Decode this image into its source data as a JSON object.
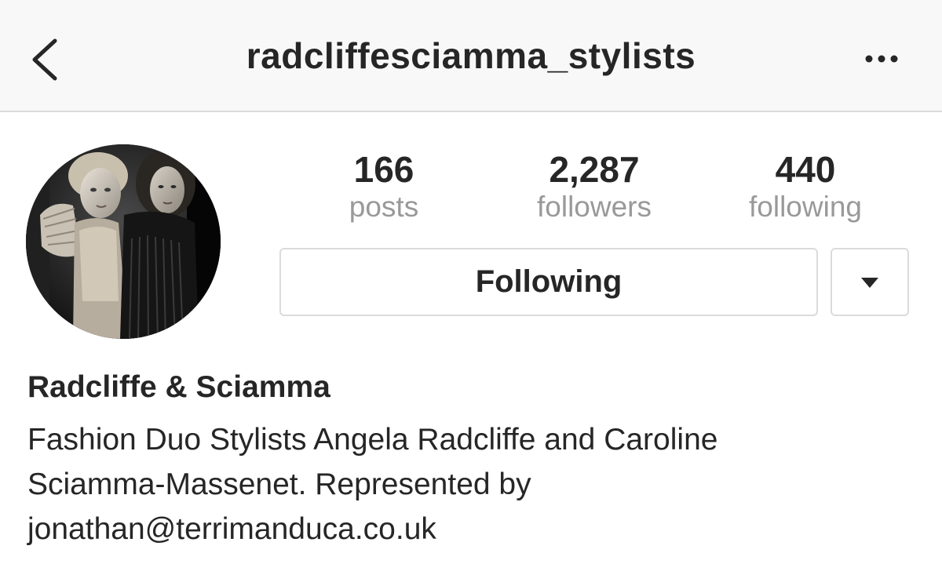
{
  "header": {
    "username": "radcliffesciamma_stylists",
    "back_icon": "chevron-left-icon",
    "more_icon": "ellipsis-icon"
  },
  "profile": {
    "stats": [
      {
        "count": "166",
        "label": "posts"
      },
      {
        "count": "2,287",
        "label": "followers"
      },
      {
        "count": "440",
        "label": "following"
      }
    ],
    "following_button_label": "Following",
    "dropdown_icon": "caret-down-icon",
    "name": "Radcliffe & Sciamma",
    "bio_lines": [
      "Fashion Duo Stylists Angela Radcliffe and Caroline",
      "Sciamma-Massenet. Represented by",
      "jonathan@terrimanduca.co.uk"
    ]
  },
  "colors": {
    "text_primary": "#262626",
    "text_secondary": "#999999",
    "border": "#dbdbdb",
    "header_bg": "#f8f8f8"
  }
}
